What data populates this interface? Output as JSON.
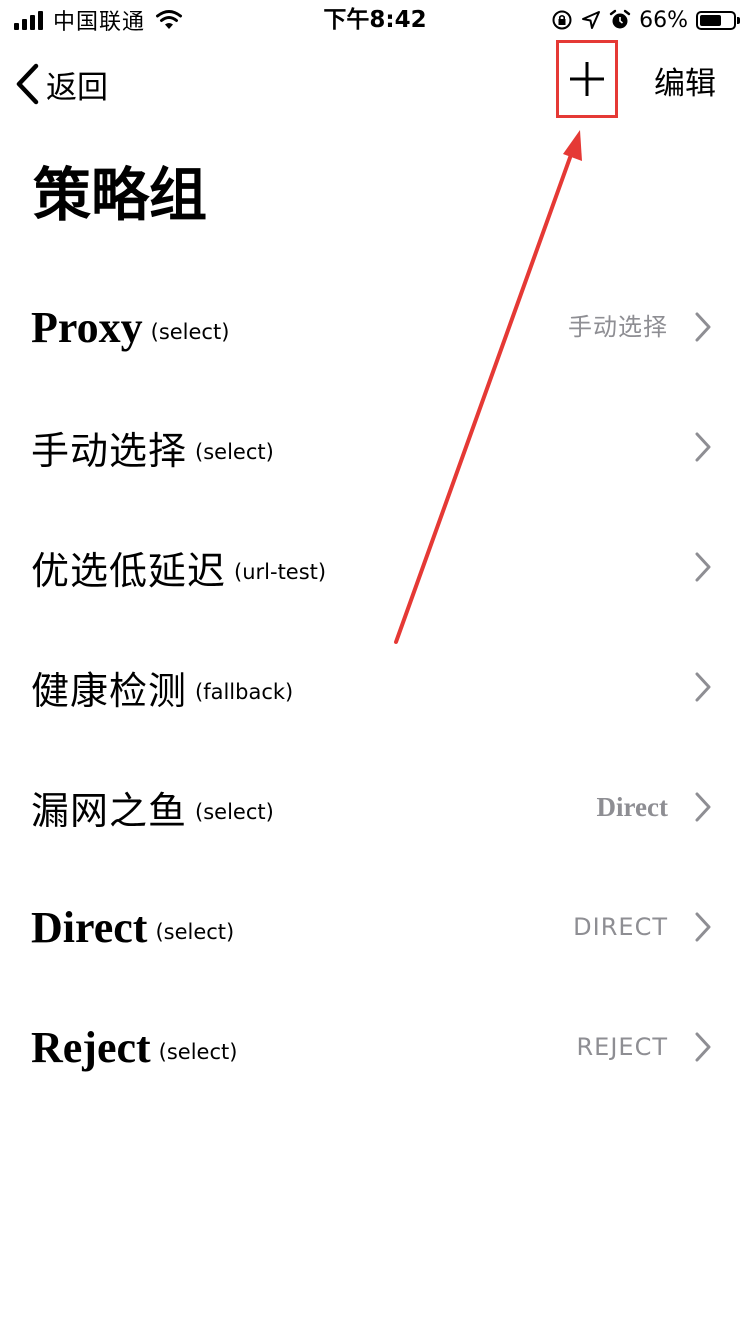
{
  "status_bar": {
    "carrier": "中国联通",
    "time": "下午8:42",
    "battery_percent": "66%",
    "battery_level": 0.66,
    "icons": [
      "signal-icon",
      "wifi-icon",
      "orientation-lock-icon",
      "location-icon",
      "alarm-icon",
      "battery-icon"
    ]
  },
  "nav": {
    "back_label": "返回",
    "add_icon": "plus-icon",
    "edit_label": "编辑"
  },
  "page": {
    "title": "策略组"
  },
  "groups": [
    {
      "name": "Proxy",
      "type": "(select)",
      "value": "手动选择"
    },
    {
      "name": "手动选择",
      "type": "(select)",
      "value": ""
    },
    {
      "name": "优选低延迟",
      "type": "(url-test)",
      "value": ""
    },
    {
      "name": "健康检测",
      "type": "(fallback)",
      "value": ""
    },
    {
      "name": "漏网之鱼",
      "type": "(select)",
      "value": "Direct"
    },
    {
      "name": "Direct",
      "type": "(select)",
      "value": "DIRECT"
    },
    {
      "name": "Reject",
      "type": "(select)",
      "value": "REJECT"
    }
  ],
  "colors": {
    "annotation": "#e53935",
    "secondary_text": "#8e8e93",
    "chevron": "#8e8e93"
  }
}
